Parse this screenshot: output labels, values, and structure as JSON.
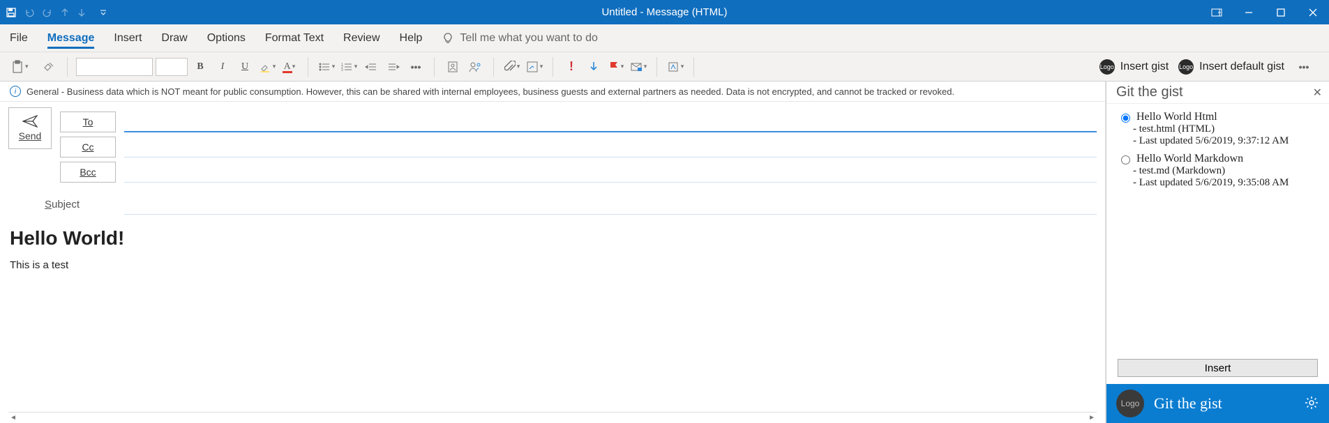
{
  "titlebar": {
    "title": "Untitled  -  Message (HTML)"
  },
  "tabs": {
    "file": "File",
    "message": "Message",
    "insert": "Insert",
    "draw": "Draw",
    "options": "Options",
    "format_text": "Format Text",
    "review": "Review",
    "help": "Help",
    "tell_me": "Tell me what you want to do"
  },
  "ribbon": {
    "font_name": "",
    "font_size": "",
    "addin1": "Insert gist",
    "addin2": "Insert default gist",
    "badge": "Logo"
  },
  "info_bar": {
    "text": "General - Business data which is NOT meant for public consumption. However, this can be shared with internal employees, business guests and external partners as needed. Data is not encrypted, and cannot be tracked or revoked."
  },
  "compose": {
    "send": "Send",
    "to_label": "To",
    "cc_label": "Cc",
    "bcc_label": "Bcc",
    "to_value": "",
    "cc_value": "",
    "bcc_value": "",
    "subject_label": "Subject",
    "subject_value": "",
    "body_heading": "Hello World!",
    "body_text": "This is a test"
  },
  "pane": {
    "title": "Git the gist",
    "insert_label": "Insert",
    "footer_title": "Git the gist",
    "footer_logo": "Logo",
    "gists": [
      {
        "name": "Hello World Html",
        "file": "test.html (HTML)",
        "updated": "Last updated 5/6/2019, 9:37:12 AM",
        "selected": true
      },
      {
        "name": "Hello World Markdown",
        "file": "test.md (Markdown)",
        "updated": "Last updated 5/6/2019, 9:35:08 AM",
        "selected": false
      }
    ]
  }
}
